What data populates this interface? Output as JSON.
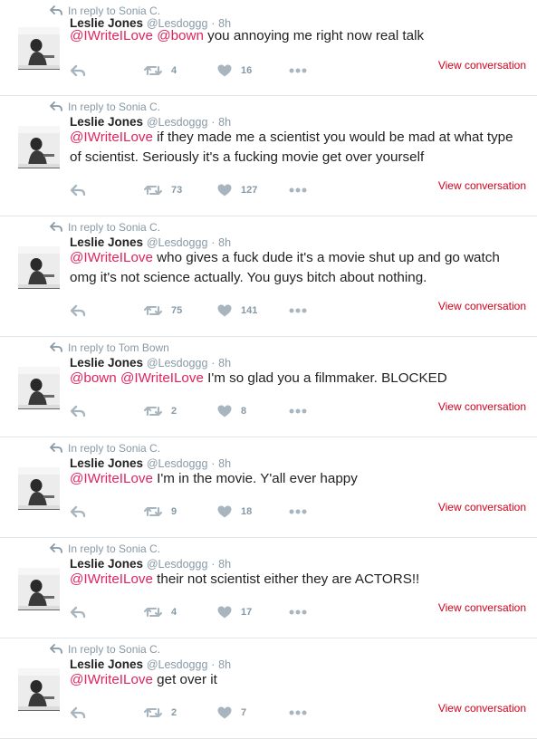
{
  "colors": {
    "mention": "#e0245e",
    "muted": "#8899a6",
    "link": "#d0021b"
  },
  "icons": {
    "reply_context": "reply-arrow-icon",
    "reply": "reply-icon",
    "retweet": "retweet-icon",
    "like": "heart-icon",
    "more": "more-dots-icon"
  },
  "tweets": [
    {
      "reply_context": "In reply to Sonia C.",
      "name": "Leslie Jones",
      "handle": "@Lesdoggg",
      "dot": "·",
      "time": "8h",
      "segments": [
        {
          "text": "@IWriteILove",
          "mention": true
        },
        {
          "text": " ",
          "mention": false
        },
        {
          "text": "@bown",
          "mention": true
        },
        {
          "text": " you annoying me right now real talk",
          "mention": false
        }
      ],
      "retweets": "4",
      "likes": "16",
      "view_conversation": "View conversation"
    },
    {
      "reply_context": "In reply to Sonia C.",
      "name": "Leslie Jones",
      "handle": "@Lesdoggg",
      "dot": "·",
      "time": "8h",
      "segments": [
        {
          "text": "@IWriteILove",
          "mention": true
        },
        {
          "text": " if they made me a scientist you would be mad at what type of scientist. Seriously it's a fucking movie get over yourself",
          "mention": false
        }
      ],
      "retweets": "73",
      "likes": "127",
      "view_conversation": "View conversation"
    },
    {
      "reply_context": "In reply to Sonia C.",
      "name": "Leslie Jones",
      "handle": "@Lesdoggg",
      "dot": "·",
      "time": "8h",
      "segments": [
        {
          "text": "@IWriteILove",
          "mention": true
        },
        {
          "text": " who gives a fuck dude it's a movie shut up and go watch omg it's not science actually. You guys bitch about nothing.",
          "mention": false
        }
      ],
      "retweets": "75",
      "likes": "141",
      "view_conversation": "View conversation"
    },
    {
      "reply_context": "In reply to Tom Bown",
      "name": "Leslie Jones",
      "handle": "@Lesdoggg",
      "dot": "·",
      "time": "8h",
      "segments": [
        {
          "text": "@bown",
          "mention": true
        },
        {
          "text": " ",
          "mention": false
        },
        {
          "text": "@IWriteILove",
          "mention": true
        },
        {
          "text": " I'm so glad you a filmmaker. BLOCKED",
          "mention": false
        }
      ],
      "retweets": "2",
      "likes": "8",
      "view_conversation": "View conversation"
    },
    {
      "reply_context": "In reply to Sonia C.",
      "name": "Leslie Jones",
      "handle": "@Lesdoggg",
      "dot": "·",
      "time": "8h",
      "segments": [
        {
          "text": "@IWriteILove",
          "mention": true
        },
        {
          "text": " I'm in the movie. Y'all ever happy",
          "mention": false
        }
      ],
      "retweets": "9",
      "likes": "18",
      "view_conversation": "View conversation"
    },
    {
      "reply_context": "In reply to Sonia C.",
      "name": "Leslie Jones",
      "handle": "@Lesdoggg",
      "dot": "·",
      "time": "8h",
      "segments": [
        {
          "text": "@IWriteILove",
          "mention": true
        },
        {
          "text": " their not scientist either they are ACTORS!!",
          "mention": false
        }
      ],
      "retweets": "4",
      "likes": "17",
      "view_conversation": "View conversation"
    },
    {
      "reply_context": "In reply to Sonia C.",
      "name": "Leslie Jones",
      "handle": "@Lesdoggg",
      "dot": "·",
      "time": "8h",
      "segments": [
        {
          "text": "@IWriteILove",
          "mention": true
        },
        {
          "text": " get over it",
          "mention": false
        }
      ],
      "retweets": "2",
      "likes": "7",
      "view_conversation": "View conversation"
    }
  ]
}
